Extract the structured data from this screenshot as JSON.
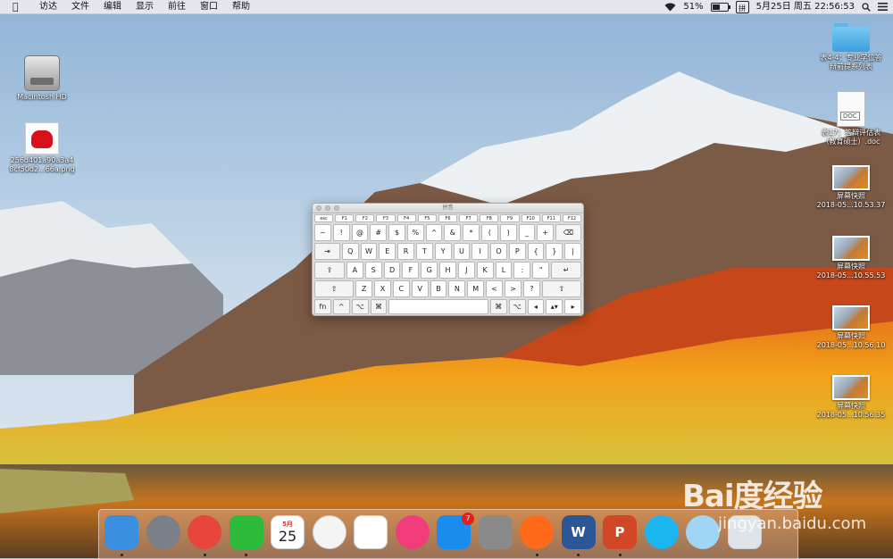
{
  "menubar": {
    "apple_icon": "apple-logo-icon",
    "items": [
      "访达",
      "文件",
      "编辑",
      "显示",
      "前往",
      "窗口",
      "帮助"
    ],
    "battery_percent": "51%",
    "battery_level": 0.51,
    "ime_label": "拼",
    "datetime": "5月25日 周五  22:56:53"
  },
  "desktop": {
    "left_icons": [
      {
        "label": "Macintosh HD",
        "icon": "hard-drive-icon"
      },
      {
        "label": "256d401a90a3a4\n8cf50d2...66a.png",
        "icon": "png-file-icon"
      }
    ],
    "right_icons": [
      {
        "label": "表4-4：专业学位答\n辩前提系列表",
        "icon": "folder-icon"
      },
      {
        "label": "表17：答辩评估表\n（教育硕士）.doc",
        "icon": "doc-file-icon",
        "doc_tag": "DOC"
      },
      {
        "label": "屏幕快照\n2018-05...10.53.37",
        "icon": "screenshot-file-icon"
      },
      {
        "label": "屏幕快照\n2018-05...10.55.53",
        "icon": "screenshot-file-icon"
      },
      {
        "label": "屏幕快照\n2018-05...10.56.10",
        "icon": "screenshot-file-icon"
      },
      {
        "label": "屏幕快照\n2018-05...10.56.35",
        "icon": "screenshot-file-icon"
      }
    ]
  },
  "keyboard_viewer": {
    "title": "拼音",
    "rows": [
      [
        "esc",
        "F1",
        "F2",
        "F3",
        "F4",
        "F5",
        "F6",
        "F7",
        "F8",
        "F9",
        "F10",
        "F11",
        "F12"
      ],
      [
        "~",
        "!",
        "@",
        "#",
        "$",
        "%",
        "^",
        "&",
        "*",
        "(",
        ")",
        "_",
        "+",
        "⌫"
      ],
      [
        "⇥",
        "Q",
        "W",
        "E",
        "R",
        "T",
        "Y",
        "U",
        "I",
        "O",
        "P",
        "{",
        "}",
        "|"
      ],
      [
        "⇪",
        "A",
        "S",
        "D",
        "F",
        "G",
        "H",
        "J",
        "K",
        "L",
        ":",
        "\"",
        "↵"
      ],
      [
        "⇧",
        "Z",
        "X",
        "C",
        "V",
        "B",
        "N",
        "M",
        "<",
        ">",
        "?",
        "⇧"
      ],
      [
        "fn",
        "^",
        "⌥",
        "⌘",
        "",
        "⌘",
        "⌥",
        "◂",
        "▴▾",
        "▸"
      ]
    ]
  },
  "dock": {
    "apps": [
      {
        "name": "finder",
        "color": "#3b8fe0",
        "running": true
      },
      {
        "name": "launchpad",
        "color": "#7a7f88",
        "running": false
      },
      {
        "name": "chrome",
        "color": "#e8453c",
        "running": true
      },
      {
        "name": "wechat",
        "color": "#2dbb3b",
        "running": true
      },
      {
        "name": "calendar",
        "color": "#ffffff",
        "date_month": "5月",
        "date_day": "25",
        "running": false
      },
      {
        "name": "photos",
        "color": "#f4f4f4",
        "running": false
      },
      {
        "name": "numbers",
        "color": "#ffffff",
        "running": false
      },
      {
        "name": "itunes",
        "color": "#f03c7a",
        "running": false
      },
      {
        "name": "app-store",
        "color": "#1a8cf0",
        "badge": "7",
        "running": false
      },
      {
        "name": "system-preferences",
        "color": "#8a8a8a",
        "running": false
      },
      {
        "name": "video-player",
        "color": "#ff6a1a",
        "running": true
      },
      {
        "name": "word",
        "color": "#2b5797",
        "glyph": "W",
        "running": true
      },
      {
        "name": "powerpoint",
        "color": "#d24726",
        "glyph": "P",
        "running": true
      },
      {
        "name": "media-player",
        "color": "#1bb6f0",
        "running": false
      },
      {
        "name": "downloads",
        "color": "#9fd6f6",
        "running": false
      },
      {
        "name": "trash",
        "color": "#dfe4e8",
        "running": false
      }
    ]
  },
  "watermark": {
    "logo": "Bai度经验",
    "url": "jingyan.baidu.com"
  }
}
